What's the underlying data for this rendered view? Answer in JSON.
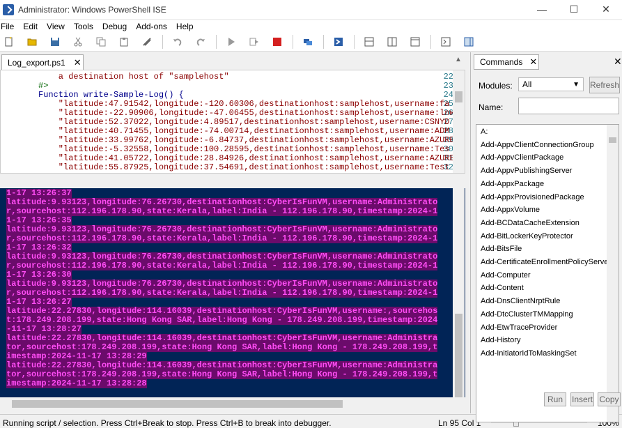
{
  "window": {
    "title": "Administrator: Windows PowerShell ISE",
    "minimize": "—",
    "maximize": "☐",
    "close": "✕"
  },
  "menu": [
    "File",
    "Edit",
    "View",
    "Tools",
    "Debug",
    "Add-ons",
    "Help"
  ],
  "editor": {
    "tab_label": "Log_export.ps1",
    "tab_close": "✕",
    "lines": [
      {
        "num": "22",
        "text": "    a destination host of \"samplehost\""
      },
      {
        "num": "23",
        "text": "#>"
      },
      {
        "num": "24",
        "text": "Function write-Sample-Log() {"
      },
      {
        "num": "25",
        "text": "    \"latitude:47.91542,longitude:-120.60306,destinationhost:samplehost,username:fa"
      },
      {
        "num": "26",
        "text": "    \"latitude:-22.90906,longitude:-47.06455,destinationhost:samplehost,username:lnw"
      },
      {
        "num": "27",
        "text": "    \"latitude:52.37022,longitude:4.89517,destinationhost:samplehost,username:CSNYD"
      },
      {
        "num": "28",
        "text": "    \"latitude:40.71455,longitude:-74.00714,destinationhost:samplehost,username:ADM"
      },
      {
        "num": "29",
        "text": "    \"latitude:33.99762,longitude:-6.84737,destinationhost:samplehost,username:AZURE"
      },
      {
        "num": "30",
        "text": "    \"latitude:-5.32558,longitude:100.28595,destinationhost:samplehost,username:Tes"
      },
      {
        "num": "31",
        "text": "    \"latitude:41.05722,longitude:28.84926,destinationhost:samplehost,username:AZURE"
      },
      {
        "num": "32",
        "text": "    \"latitude:55.87925,longitude:37.54691,destinationhost:samplehost,username:Test"
      }
    ]
  },
  "console": {
    "lines": [
      "1-17 13:26:37",
      "latitude:9.93123,longitude:76.26730,destinationhost:CyberIsFunVM,username:Administrato",
      "r,sourcehost:112.196.178.90,state:Kerala,label:India - 112.196.178.90,timestamp:2024-1",
      "1-17 13:26:35",
      "latitude:9.93123,longitude:76.26730,destinationhost:CyberIsFunVM,username:Administrato",
      "r,sourcehost:112.196.178.90,state:Kerala,label:India - 112.196.178.90,timestamp:2024-1",
      "1-17 13:26:32",
      "latitude:9.93123,longitude:76.26730,destinationhost:CyberIsFunVM,username:Administrato",
      "r,sourcehost:112.196.178.90,state:Kerala,label:India - 112.196.178.90,timestamp:2024-1",
      "1-17 13:26:30",
      "latitude:9.93123,longitude:76.26730,destinationhost:CyberIsFunVM,username:Administrato",
      "r,sourcehost:112.196.178.90,state:Kerala,label:India - 112.196.178.90,timestamp:2024-1",
      "1-17 13:26:27",
      "latitude:22.27830,longitude:114.16039,destinationhost:CyberIsFunVM,username:,sourcehos",
      "t:178.249.208.199,state:Hong Kong SAR,label:Hong Kong - 178.249.208.199,timestamp:2024",
      "-11-17 13:28:27",
      "latitude:22.27830,longitude:114.16039,destinationhost:CyberIsFunVM,username:Administra",
      "tor,sourcehost:178.249.208.199,state:Hong Kong SAR,label:Hong Kong - 178.249.208.199,t",
      "imestamp:2024-11-17 13:28:29",
      "latitude:22.27830,longitude:114.16039,destinationhost:CyberIsFunVM,username:Administra",
      "tor,sourcehost:178.249.208.199,state:Hong Kong SAR,label:Hong Kong - 178.249.208.199,t",
      "imestamp:2024-11-17 13:28:28"
    ],
    "colors": {
      "background": "#012456",
      "text": "#ff4df5",
      "highlight": "#6b0b6b"
    }
  },
  "status": {
    "message": "Running script / selection.  Press Ctrl+Break to stop.  Press Ctrl+B to break into debugger.",
    "position": "Ln 95  Col 1",
    "zoom": "100%"
  },
  "commands": {
    "tab_label": "Commands",
    "tab_close": "✕",
    "panel_close": "✕",
    "modules_label": "Modules:",
    "modules_value": "All",
    "refresh_label": "Refresh",
    "name_label": "Name:",
    "name_value": "",
    "items": [
      "A:",
      "Add-AppvClientConnectionGroup",
      "Add-AppvClientPackage",
      "Add-AppvPublishingServer",
      "Add-AppxPackage",
      "Add-AppxProvisionedPackage",
      "Add-AppxVolume",
      "Add-BCDataCacheExtension",
      "Add-BitLockerKeyProtector",
      "Add-BitsFile",
      "Add-CertificateEnrollmentPolicyServe",
      "Add-Computer",
      "Add-Content",
      "Add-DnsClientNrptRule",
      "Add-DtcClusterTMMapping",
      "Add-EtwTraceProvider",
      "Add-History",
      "Add-InitiatorIdToMaskingSet"
    ],
    "run_label": "Run",
    "insert_label": "Insert",
    "copy_label": "Copy"
  },
  "toolbar_icons": [
    "new-icon",
    "open-icon",
    "save-icon",
    "cut-icon",
    "copy-icon",
    "paste-icon",
    "clear-icon",
    "undo-icon",
    "redo-icon",
    "run-icon",
    "run-selection-icon",
    "stop-icon",
    "remote-icon",
    "powershell-icon",
    "show-script-top-icon",
    "show-script-right-icon",
    "show-script-max-icon",
    "show-command-window-icon",
    "show-command-addon-icon"
  ]
}
